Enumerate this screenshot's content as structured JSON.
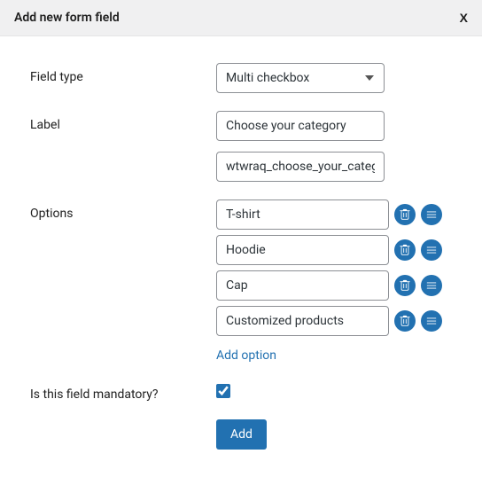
{
  "header": {
    "title": "Add new form field",
    "close": "X"
  },
  "form": {
    "field_type": {
      "label": "Field type",
      "value": "Multi checkbox"
    },
    "label_field": {
      "label": "Label",
      "value": "Choose your category",
      "slug": "wtwraq_choose_your_category"
    },
    "options": {
      "label": "Options",
      "items": [
        "T-shirt",
        "Hoodie",
        "Cap",
        "Customized products"
      ],
      "add_link": "Add option"
    },
    "mandatory": {
      "label": "Is this field mandatory?",
      "checked": true
    },
    "submit": {
      "label": "Add"
    }
  }
}
